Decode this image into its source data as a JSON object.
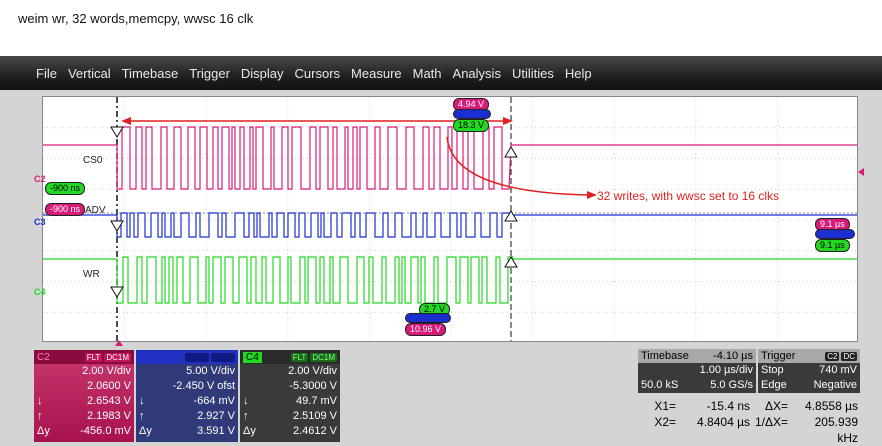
{
  "caption": "weim wr, 32 words,memcpy, wwsc 16 clk",
  "menu": [
    "File",
    "Vertical",
    "Timebase",
    "Trigger",
    "Display",
    "Cursors",
    "Measure",
    "Math",
    "Analysis",
    "Utilities",
    "Help"
  ],
  "channels": {
    "c2": {
      "label": "C2",
      "color": "#d81b7a"
    },
    "c3": {
      "label": "C3",
      "color": "#1b2fd0"
    },
    "c4": {
      "label": "C4",
      "color": "#22d822"
    }
  },
  "traces": {
    "cs0": "CS0",
    "adv": "ADV",
    "wr": "WR"
  },
  "tags": {
    "top1": "4.94 V",
    "top3": "18.3 V",
    "left1": "-900 ns",
    "left2": "-900 ns",
    "right1": "9.1 µs",
    "right3": "9.1 µs",
    "mid1": "2.7 V",
    "mid2": "10.96 V"
  },
  "annotation": "32 writes, with wwsc set to 16 clks",
  "panel_c2": {
    "title": "C2",
    "flt": "FLT",
    "dc": "DC1M",
    "rows": [
      [
        "",
        "2.00 V/div"
      ],
      [
        "",
        "2.0600 V"
      ],
      [
        "↓",
        "2.6543 V"
      ],
      [
        "↑",
        "2.1983 V"
      ],
      [
        "Δy",
        "-456.0 mV"
      ]
    ]
  },
  "panel_c3": {
    "title": "",
    "rows": [
      [
        "",
        "5.00 V/div"
      ],
      [
        "",
        "-2.450 V ofst"
      ],
      [
        "↓",
        "-664 mV"
      ],
      [
        "↑",
        "2.927 V"
      ],
      [
        "Δy",
        "3.591 V"
      ]
    ]
  },
  "panel_c4": {
    "title": "C4",
    "flt": "FLT",
    "dc": "DC1M",
    "rows": [
      [
        "",
        "2.00 V/div"
      ],
      [
        "",
        "-5.3000 V"
      ],
      [
        "↓",
        "49.7 mV"
      ],
      [
        "↑",
        "2.5109 V"
      ],
      [
        "Δy",
        "2.4612 V"
      ]
    ]
  },
  "timebase": {
    "label": "Timebase",
    "value": "-4.10 µs",
    "div": "1.00 µs/div",
    "samples": "50.0 kS",
    "rate": "5.0 GS/s"
  },
  "trigger": {
    "label": "Trigger",
    "ch": "C2",
    "dc": "DC",
    "mode": "Stop",
    "level": "740 mV",
    "type": "Edge",
    "slope": "Negative"
  },
  "cursors": {
    "x1_label": "X1=",
    "x1": "-15.4 ns",
    "dx_label": "ΔX=",
    "dx": "4.8558 µs",
    "x2_label": "X2=",
    "x2": "4.8404 µs",
    "inv_label": "1/ΔX=",
    "inv": "205.939 kHz"
  }
}
